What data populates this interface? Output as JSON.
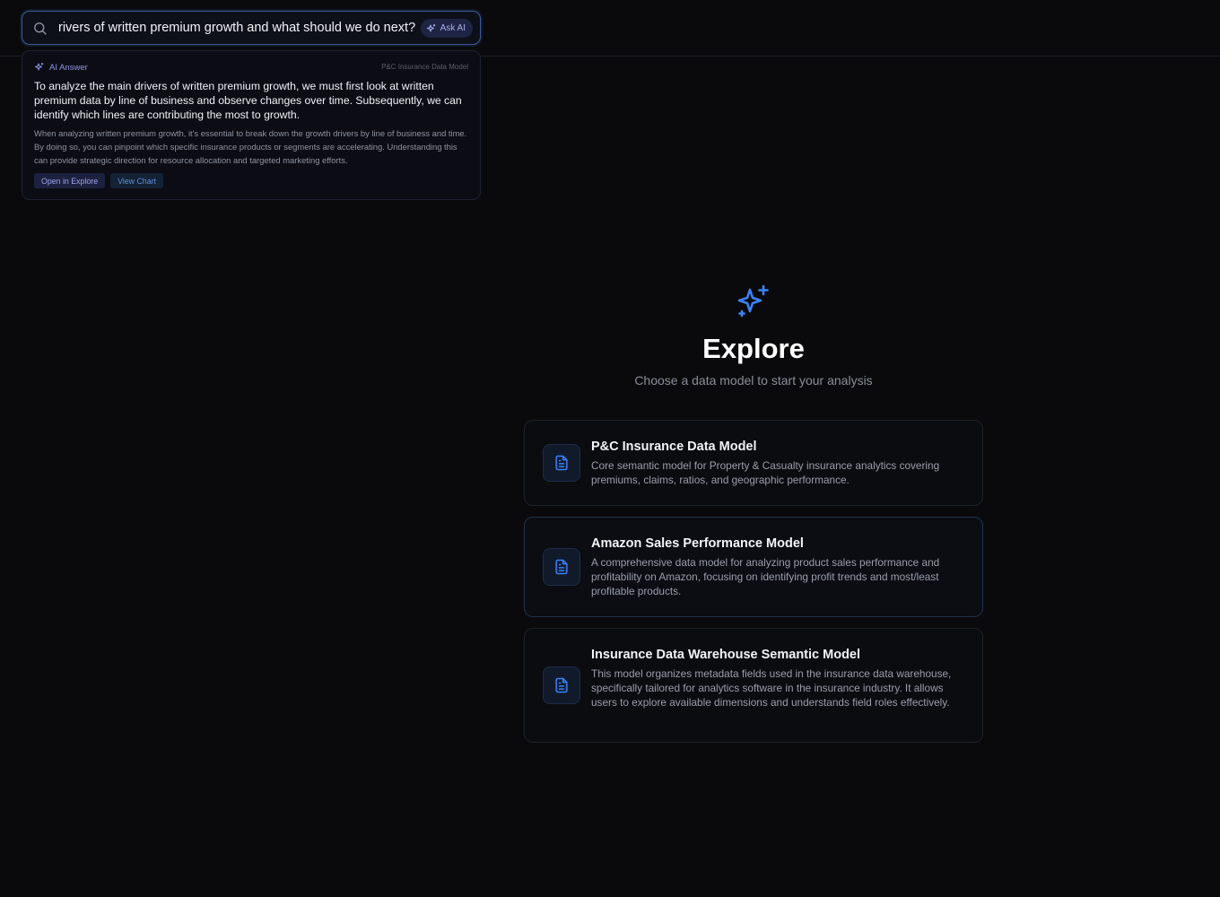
{
  "search": {
    "value": "rivers of written premium growth and what should we do next?",
    "ask_ai_label": "Ask AI"
  },
  "ai_answer": {
    "header": "AI Answer",
    "model": "P&C Insurance Data Model",
    "main_text": "To analyze the main drivers of written premium growth, we must first look at written premium data by line of business and observe changes over time. Subsequently, we can identify which lines are contributing the most to growth.",
    "sub_text": "When analyzing written premium growth, it's essential to break down the growth drivers by line of business and time. By doing so, you can pinpoint which specific insurance products or segments are accelerating. Understanding this can provide strategic direction for resource allocation and targeted marketing efforts.",
    "open_in_explore_label": "Open in Explore",
    "view_chart_label": "View Chart"
  },
  "hero": {
    "icon": "sparkle-icon",
    "title": "Explore",
    "subtitle": "Choose a data model to start your analysis"
  },
  "models": [
    {
      "title": "P&C Insurance Data Model",
      "description": "Core semantic model for Property & Casualty insurance analytics covering premiums, claims, ratios, and geographic performance."
    },
    {
      "title": "Amazon Sales Performance Model",
      "description": "A comprehensive data model for analyzing product sales performance and profitability on Amazon, focusing on identifying profit trends and most/least profitable products."
    },
    {
      "title": "Insurance Data Warehouse Semantic Model",
      "description": "This model organizes metadata fields used in the insurance data warehouse, specifically tailored for analytics software in the insurance industry. It allows users to explore available dimensions and understands field roles effectively."
    }
  ],
  "colors": {
    "accent": "#3b82f6",
    "ai_accent": "#8f95e9",
    "background": "#0a0a0c"
  }
}
